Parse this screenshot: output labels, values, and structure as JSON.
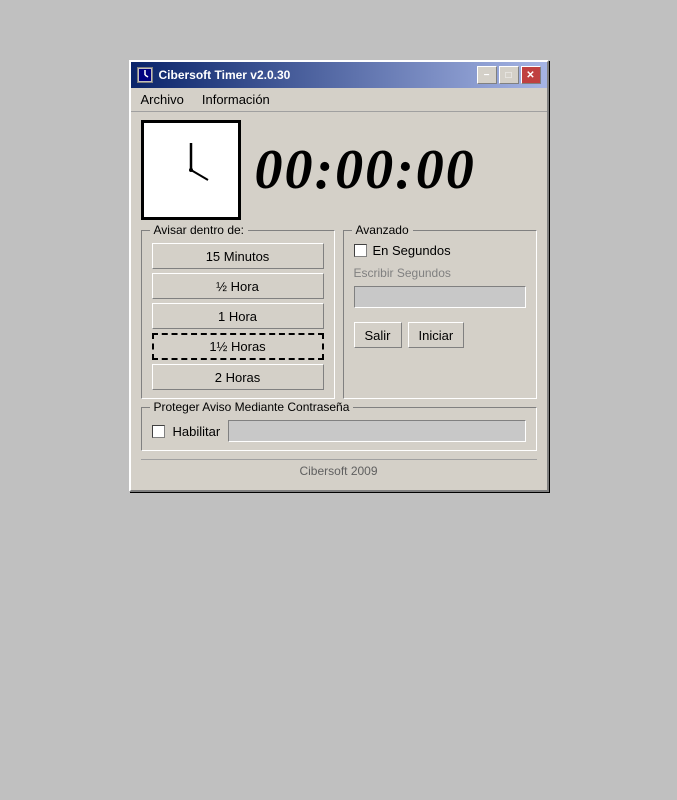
{
  "window": {
    "title": "Cibersoft Timer v2.0.30",
    "icon": "timer-icon"
  },
  "title_buttons": {
    "minimize": "−",
    "maximize": "□",
    "close": "✕"
  },
  "menu": {
    "items": [
      {
        "id": "archivo",
        "label": "Archivo"
      },
      {
        "id": "informacion",
        "label": "Información"
      }
    ]
  },
  "time_display": "00:00:00",
  "avisar_panel": {
    "legend": "Avisar dentro de:",
    "buttons": [
      {
        "id": "15min",
        "label": "15 Minutos",
        "selected": false
      },
      {
        "id": "half_hour",
        "label": "½ Hora",
        "selected": false
      },
      {
        "id": "1hora",
        "label": "1 Hora",
        "selected": false
      },
      {
        "id": "1half_hora",
        "label": "1½ Horas",
        "selected": true
      },
      {
        "id": "2horas",
        "label": "2 Horas",
        "selected": false
      }
    ]
  },
  "avanzado_panel": {
    "legend": "Avanzado",
    "checkbox_label": "En Segundos",
    "input_label": "Escribir Segundos",
    "input_value": "",
    "buttons": {
      "salir": "Salir",
      "iniciar": "Iniciar"
    }
  },
  "password_panel": {
    "legend": "Proteger Aviso Mediante Contraseña",
    "checkbox_label": "Habilitar"
  },
  "footer": "Cibersoft 2009"
}
